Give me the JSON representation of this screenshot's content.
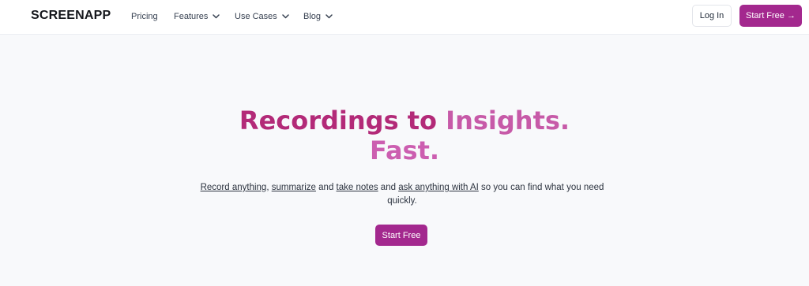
{
  "brand": {
    "logo_text": "SCREENAPP",
    "accent_color": "#a3288e"
  },
  "nav": {
    "items": [
      {
        "label": "Pricing",
        "has_dropdown": false
      },
      {
        "label": "Features",
        "has_dropdown": true
      },
      {
        "label": "Use Cases",
        "has_dropdown": true
      },
      {
        "label": "Blog",
        "has_dropdown": true
      }
    ],
    "login_label": "Log In",
    "start_free_label": "Start Free →"
  },
  "hero": {
    "title_part1": "Recordings to",
    "title_part2": "Insights.",
    "title_line2": "Fast.",
    "subtitle": {
      "link1": "Record anything",
      "sep1": ", ",
      "link2": "summarize",
      "sep2": " and ",
      "link3": "take notes",
      "sep3": " and ",
      "link4": "ask anything with AI",
      "tail": " so you can find what you need quickly."
    },
    "cta_label": "Start Free"
  }
}
